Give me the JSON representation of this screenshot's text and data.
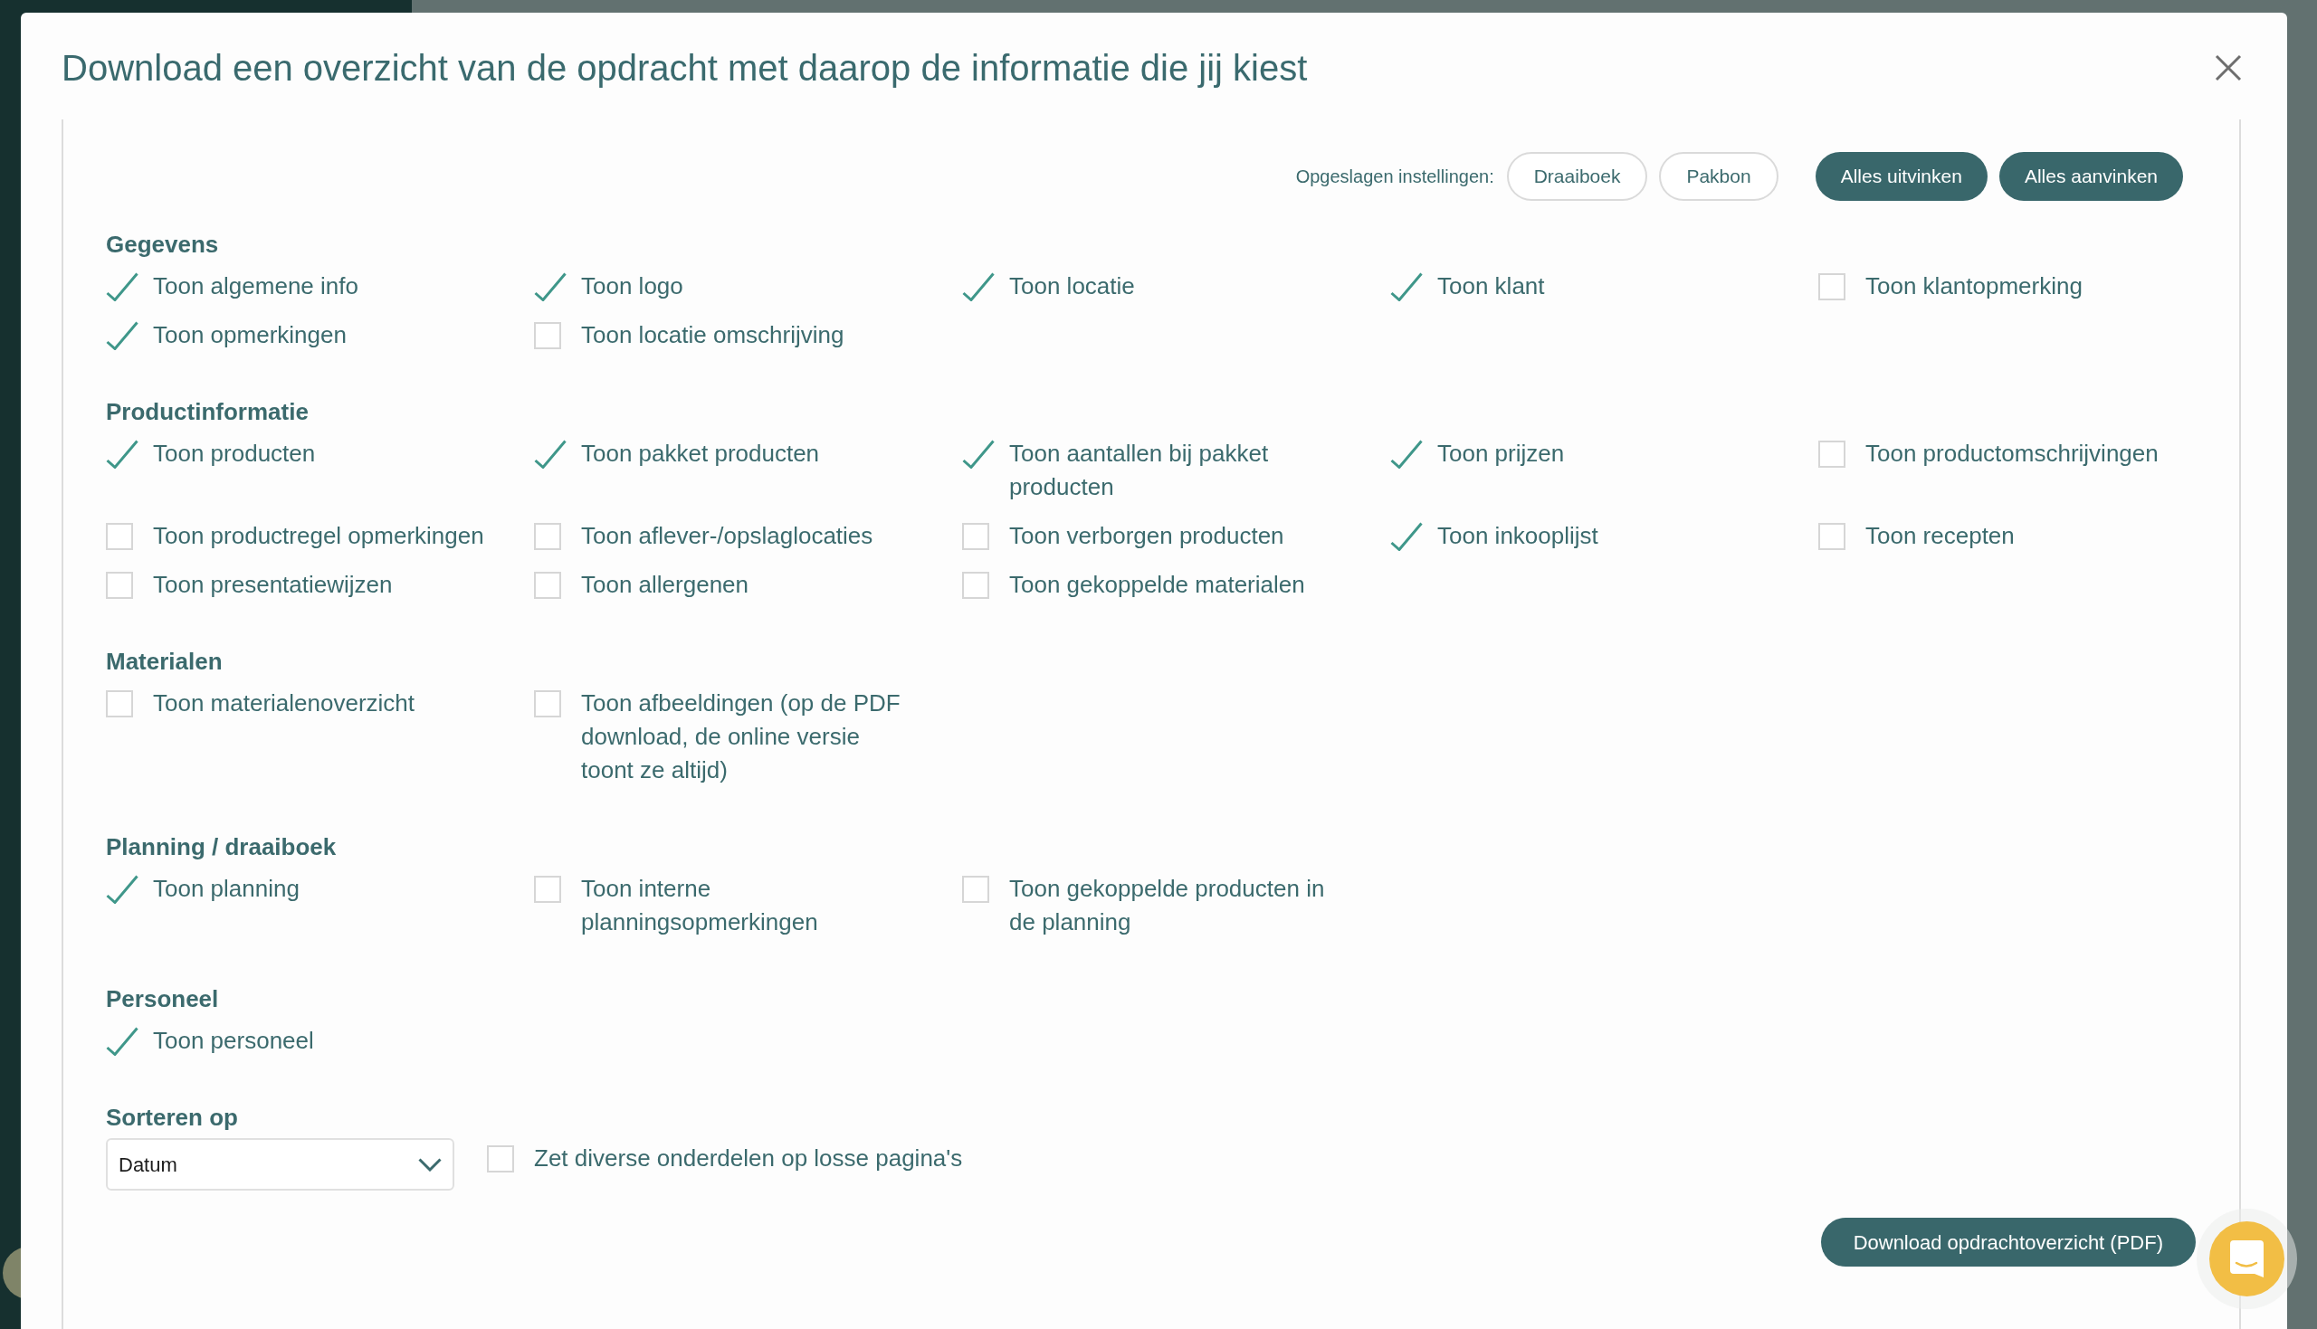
{
  "title": "Download een overzicht van de opdracht met daarop de informatie die jij kiest",
  "saved_settings": {
    "label": "Opgeslagen instellingen:",
    "presets": [
      "Draaiboek",
      "Pakbon"
    ]
  },
  "actions": [
    "Alles uitvinken",
    "Alles aanvinken"
  ],
  "sections": [
    {
      "heading": "Gegevens",
      "options": [
        {
          "label": "Toon algemene info",
          "checked": true
        },
        {
          "label": "Toon logo",
          "checked": true
        },
        {
          "label": "Toon locatie",
          "checked": true
        },
        {
          "label": "Toon klant",
          "checked": true
        },
        {
          "label": "Toon klantopmerking",
          "checked": false
        },
        {
          "label": "Toon opmerkingen",
          "checked": true
        },
        {
          "label": "Toon locatie omschrijving",
          "checked": false
        }
      ]
    },
    {
      "heading": "Productinformatie",
      "options": [
        {
          "label": "Toon producten",
          "checked": true
        },
        {
          "label": "Toon pakket producten",
          "checked": true
        },
        {
          "label": "Toon aantallen bij pakket producten",
          "checked": true
        },
        {
          "label": "Toon prijzen",
          "checked": true
        },
        {
          "label": "Toon productomschrijvingen",
          "checked": false
        },
        {
          "label": "Toon productregel opmerkingen",
          "checked": false
        },
        {
          "label": "Toon aflever-/opslaglocaties",
          "checked": false
        },
        {
          "label": "Toon verborgen producten",
          "checked": false
        },
        {
          "label": "Toon inkooplijst",
          "checked": true
        },
        {
          "label": "Toon recepten",
          "checked": false
        },
        {
          "label": "Toon presentatiewijzen",
          "checked": false
        },
        {
          "label": "Toon allergenen",
          "checked": false
        },
        {
          "label": "Toon gekoppelde materialen",
          "checked": false
        }
      ]
    },
    {
      "heading": "Materialen",
      "options": [
        {
          "label": "Toon materialenoverzicht",
          "checked": false
        },
        {
          "label": "Toon afbeeldingen (op de PDF download, de online versie toont ze altijd)",
          "checked": false
        }
      ]
    },
    {
      "heading": "Planning / draaiboek",
      "options": [
        {
          "label": "Toon planning",
          "checked": true
        },
        {
          "label": "Toon interne planningsopmerkingen",
          "checked": false
        },
        {
          "label": "Toon gekoppelde producten in de planning",
          "checked": false
        }
      ]
    },
    {
      "heading": "Personeel",
      "options": [
        {
          "label": "Toon personeel",
          "checked": true
        }
      ]
    }
  ],
  "sort": {
    "label": "Sorteren op",
    "value": "Datum"
  },
  "separate_pages": {
    "label": "Zet diverse onderdelen op losse pagina's",
    "checked": false
  },
  "download_button": "Download opdrachtoverzicht (PDF)"
}
